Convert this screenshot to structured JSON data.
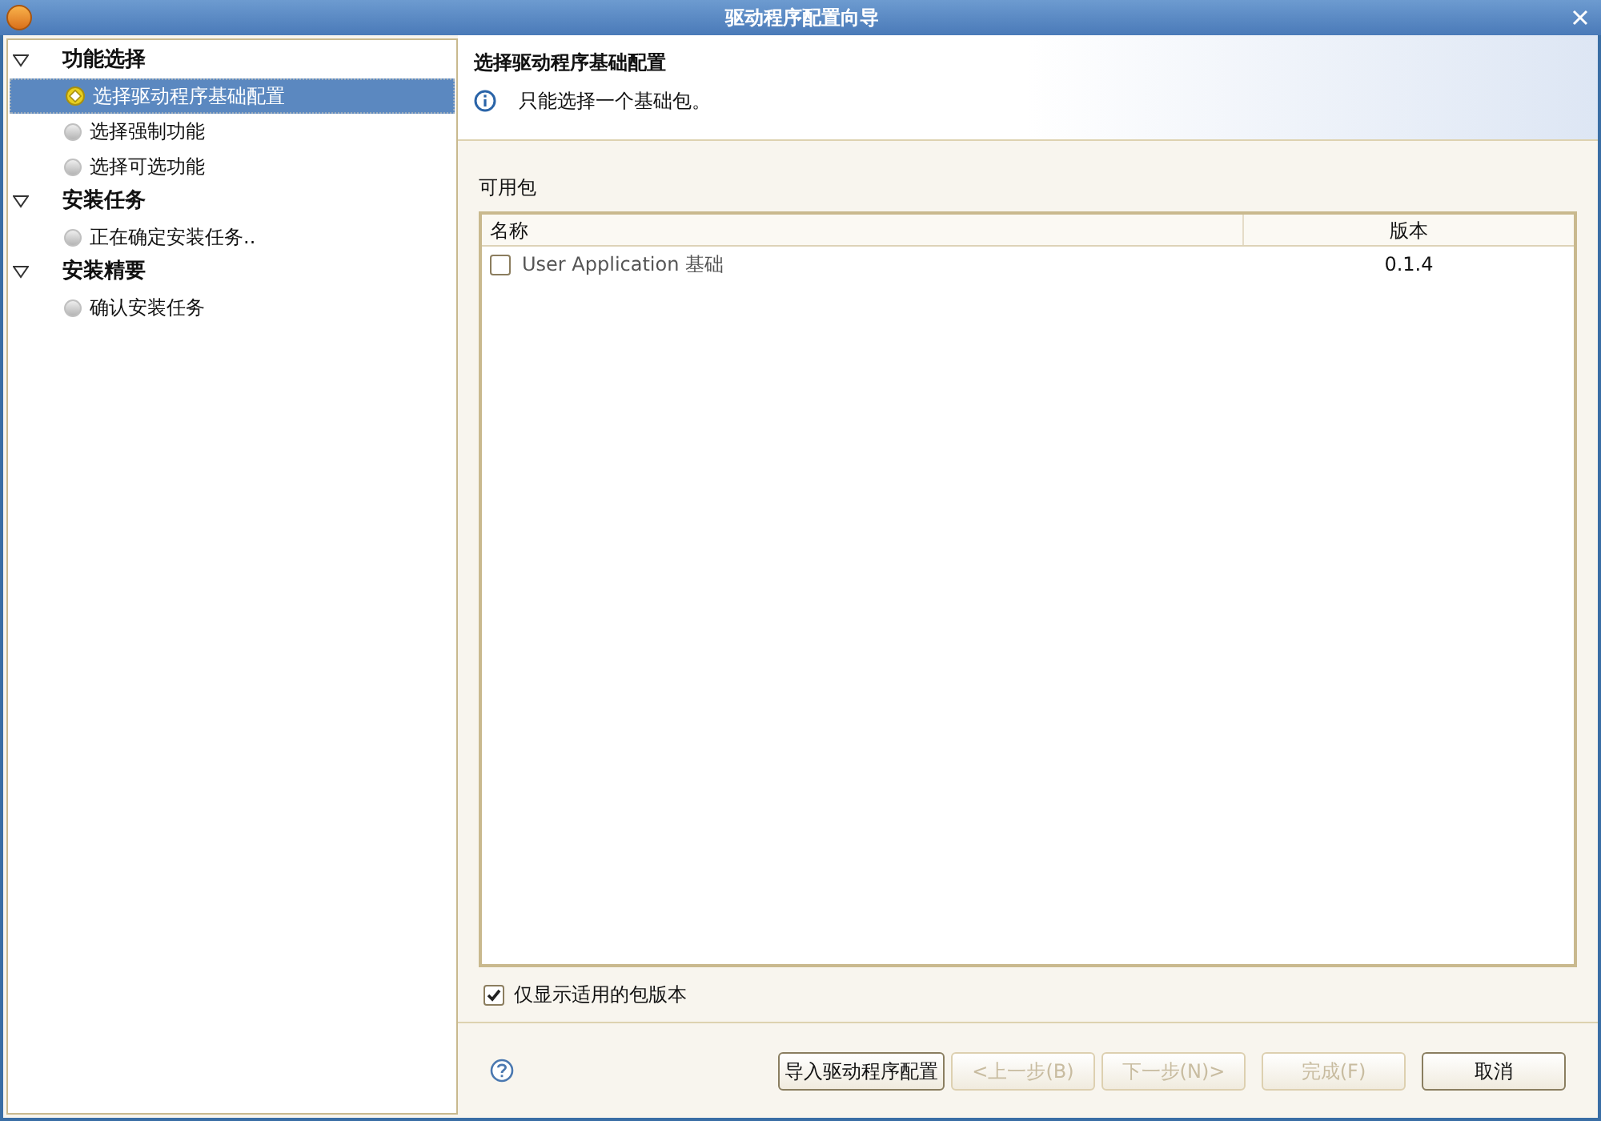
{
  "window": {
    "title": "驱动程序配置向导"
  },
  "tree": [
    {
      "label": "功能选择",
      "expanded": true,
      "children": [
        {
          "label": "选择驱动程序基础配置",
          "selected": true
        },
        {
          "label": "选择强制功能",
          "selected": false
        },
        {
          "label": "选择可选功能",
          "selected": false
        }
      ]
    },
    {
      "label": "安装任务",
      "expanded": true,
      "children": [
        {
          "label": "正在确定安装任务..",
          "selected": false
        }
      ]
    },
    {
      "label": "安装精要",
      "expanded": true,
      "children": [
        {
          "label": "确认安装任务",
          "selected": false
        }
      ]
    }
  ],
  "header": {
    "title": "选择驱动程序基础配置",
    "message": "只能选择一个基础包。"
  },
  "packages": {
    "label": "可用包",
    "columns": [
      "名称",
      "版本"
    ],
    "rows": [
      {
        "name": "User Application 基础",
        "version": "0.1.4",
        "checked": false
      }
    ]
  },
  "filter": {
    "label": "仅显示适用的包版本",
    "checked": true
  },
  "buttons": [
    {
      "label": "导入驱动程序配置",
      "disabled": false
    },
    {
      "label": "<上一步(B)",
      "disabled": true
    },
    {
      "label": "下一步(N)>",
      "disabled": true
    },
    {
      "label": "完成(F)",
      "disabled": true
    },
    {
      "label": "取消",
      "disabled": false
    }
  ]
}
